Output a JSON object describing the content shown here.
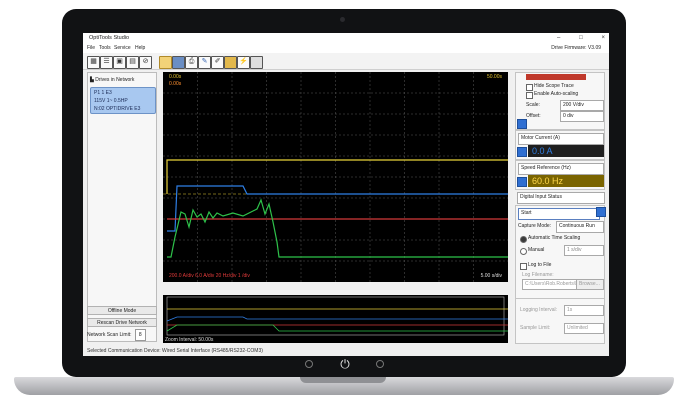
{
  "app": {
    "title": "OptiTools Studio",
    "firmware": "Drive Firmware: V3.09"
  },
  "window_controls": [
    "–",
    "□",
    "×"
  ],
  "menu": [
    "File",
    "Tools",
    "Service",
    "Help"
  ],
  "toolbar_icons": [
    "grid-icon",
    "list-icon",
    "monitor-icon",
    "chart-icon",
    "no-icon",
    "folder-icon",
    "save-icon",
    "print-icon",
    "wrench-icon",
    "edit-icon",
    "parameters-icon",
    "flash-icon",
    "key-icon"
  ],
  "left_panel": {
    "header": "Drives in Network",
    "drive": {
      "line1": "P1   1  E3",
      "line2": "115V 1~  0.5HP",
      "line3": "N:02  OPTIDRIVE E3"
    },
    "offline_button": "Offline Mode",
    "rescan_button": "Rescan Drive Network",
    "scan_limit_label": "Network Scan Limit:",
    "scan_limit_value": "8"
  },
  "scope": {
    "top_left_1": "0.00s",
    "top_left_2": "0.00s",
    "top_left_3": "0.00s",
    "top_right": "50.00s",
    "bottom_right": "5.00 s/div",
    "legend": "200.0 A/div   6.0 A/div   20 Hz/div   1 /div",
    "zoom_label": "Zoom Interval: 50.00s"
  },
  "right_panel": {
    "hide_scope_trace": "Hide Scope Trace",
    "enable_auto_scaling": "Enable Auto-scaling",
    "scale_label": "Scale:",
    "scale_value": "200 V/div",
    "offset_label": "Offset:",
    "offset_value": "0 div",
    "motor_current_select": "Motor Current (A)",
    "motor_current_value": "0.0 A",
    "speed_ref_select": "Speed Reference (Hz)",
    "speed_ref_value": "60.0 Hz",
    "digital_input_select": "Digital Input Status",
    "start_button": "Start",
    "capture_mode_label": "Capture Mode:",
    "capture_mode_value": "Continuous Run",
    "auto_time_scaling": "Automatic Time Scaling",
    "manual_label": "Manual",
    "manual_value": "1 s/div",
    "log_to_file": "Log to File",
    "log_filename_label": "Log Filename:",
    "log_filename_value": "C:\\Users\\Rob.Roberts\\D",
    "browse_button": "Browse...",
    "logging_interval_label": "Logging Interval:",
    "logging_interval_value": "1s",
    "sample_limit_label": "Sample Limit:",
    "sample_limit_value": "Unlimited"
  },
  "status_bar": "Selected Communication Device: Wired Serial Interface (RS485/RS232-COM3)",
  "colors": {
    "trace_yellow": "#e8d23a",
    "trace_blue": "#2f7fe6",
    "trace_green": "#2ec24a",
    "trace_red": "#d23a3a",
    "readout_current_bg": "#1f1f1f",
    "readout_current_fg": "#2f7fe6",
    "readout_speed_bg": "#7a6400",
    "readout_speed_fg": "#ffd84a"
  }
}
